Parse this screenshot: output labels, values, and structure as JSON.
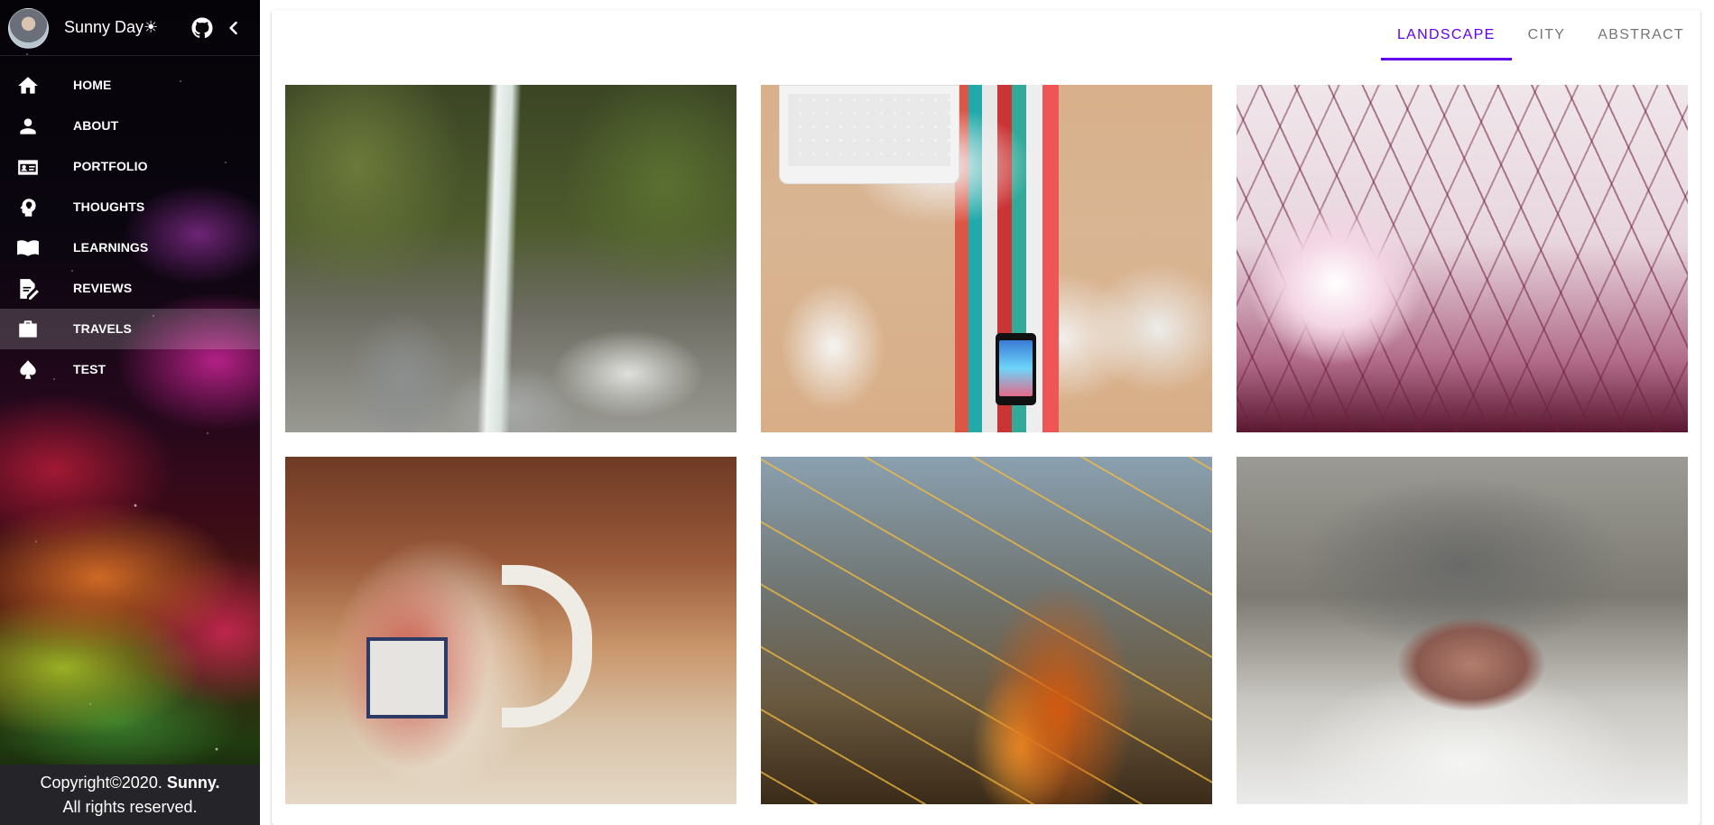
{
  "sidebar": {
    "title": "Sunny Day☀",
    "nav": [
      {
        "label": "HOME",
        "icon": "home-icon"
      },
      {
        "label": "ABOUT",
        "icon": "person-icon"
      },
      {
        "label": "PORTFOLIO",
        "icon": "badge-icon"
      },
      {
        "label": "THOUGHTS",
        "icon": "head-lightbulb-icon"
      },
      {
        "label": "LEARNINGS",
        "icon": "book-icon"
      },
      {
        "label": "REVIEWS",
        "icon": "note-edit-icon"
      },
      {
        "label": "TRAVELS",
        "icon": "briefcase-icon",
        "active": true
      },
      {
        "label": "TEST",
        "icon": "spade-icon"
      }
    ],
    "footer": {
      "line1_prefix": "Copyright©2020. ",
      "line1_bold": "Sunny.",
      "line2": "All rights reserved."
    }
  },
  "tabs": [
    {
      "label": "LANDSCAPE",
      "active": true
    },
    {
      "label": "CITY"
    },
    {
      "label": "ABSTRACT"
    }
  ],
  "gallery": {
    "photos": [
      {
        "subject": "waterfall-rocks"
      },
      {
        "subject": "desk-keyboard-books"
      },
      {
        "subject": "pink-branches"
      },
      {
        "subject": "cuba-mug"
      },
      {
        "subject": "cactus-spines"
      },
      {
        "subject": "cat-nose"
      }
    ]
  },
  "colors": {
    "accent": "#6200ee",
    "footer_bg": "#252529"
  }
}
